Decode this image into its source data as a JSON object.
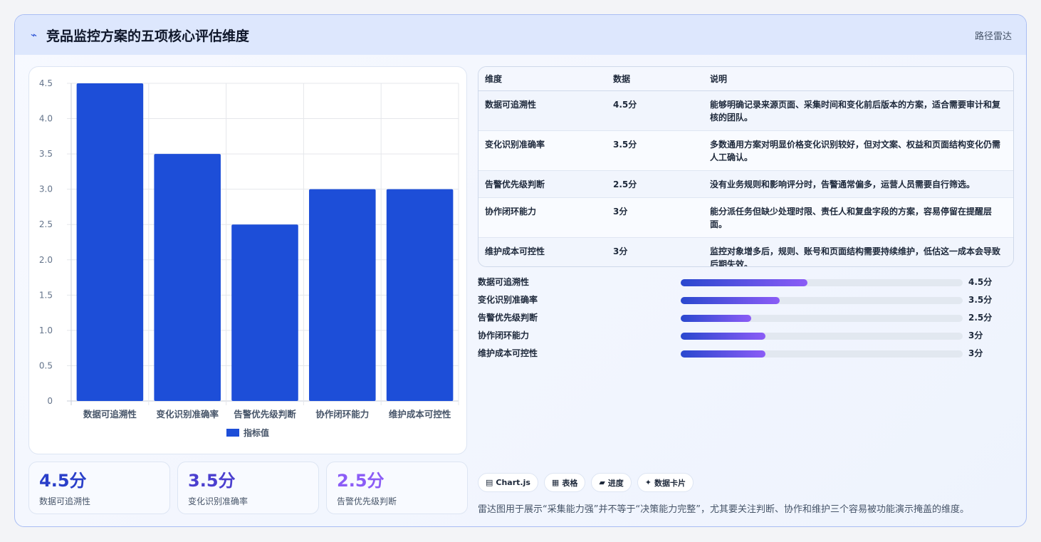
{
  "header": {
    "icon": "pulse-icon",
    "title": "竞品监控方案的五项核心评估维度",
    "tag": "路径雷达"
  },
  "chart_data": {
    "type": "bar",
    "categories": [
      "数据可追溯性",
      "变化识别准确率",
      "告警优先级判断",
      "协作闭环能力",
      "维护成本可控性"
    ],
    "series": [
      {
        "name": "指标值",
        "values": [
          4.5,
          3.5,
          2.5,
          3,
          3
        ],
        "color": "#1d4ed8"
      }
    ],
    "ylim": [
      0,
      4.5
    ],
    "yticks": [
      "0",
      "0.5",
      "1.0",
      "1.5",
      "2.0",
      "2.5",
      "3.0",
      "3.5",
      "4.0",
      "4.5"
    ],
    "grid": true,
    "legend": "bottom"
  },
  "stats": [
    {
      "value": "4.5分",
      "label": "数据可追溯性",
      "color": "#2a3fc9"
    },
    {
      "value": "3.5分",
      "label": "变化识别准确率",
      "color": "#4b3fcf"
    },
    {
      "value": "2.5分",
      "label": "告警优先级判断",
      "color": "#8b5cf6"
    }
  ],
  "table": {
    "headers": [
      "维度",
      "数据",
      "说明"
    ],
    "rows": [
      {
        "dim": "数据可追溯性",
        "score": "4.5分",
        "desc": "能够明确记录来源页面、采集时间和变化前后版本的方案，适合需要审计和复核的团队。"
      },
      {
        "dim": "变化识别准确率",
        "score": "3.5分",
        "desc": "多数通用方案对明显价格变化识别较好，但对文案、权益和页面结构变化仍需人工确认。"
      },
      {
        "dim": "告警优先级判断",
        "score": "2.5分",
        "desc": "没有业务规则和影响评分时，告警通常偏多，运营人员需要自行筛选。"
      },
      {
        "dim": "协作闭环能力",
        "score": "3分",
        "desc": "能分派任务但缺少处理时限、责任人和复盘字段的方案，容易停留在提醒层面。"
      },
      {
        "dim": "维护成本可控性",
        "score": "3分",
        "desc": "监控对象增多后，规则、账号和页面结构需要持续维护，低估这一成本会导致后期失效。"
      }
    ]
  },
  "progress": {
    "max": 10,
    "items": [
      {
        "label": "数据可追溯性",
        "value": 4.5,
        "text": "4.5分"
      },
      {
        "label": "变化识别准确率",
        "value": 3.5,
        "text": "3.5分"
      },
      {
        "label": "告警优先级判断",
        "value": 2.5,
        "text": "2.5分"
      },
      {
        "label": "协作闭环能力",
        "value": 3,
        "text": "3分"
      },
      {
        "label": "维护成本可控性",
        "value": 3,
        "text": "3分"
      }
    ]
  },
  "chips": [
    {
      "icon": "chart-icon",
      "glyph": "▤",
      "label": "Chart.js"
    },
    {
      "icon": "table-icon",
      "glyph": "▦",
      "label": "表格"
    },
    {
      "icon": "progress-icon",
      "glyph": "▰",
      "label": "进度"
    },
    {
      "icon": "card-icon",
      "glyph": "✦",
      "label": "数据卡片"
    }
  ],
  "note": "雷达图用于展示“采集能力强”并不等于“决策能力完整”，尤其要关注判断、协作和维护三个容易被功能演示掩盖的维度。"
}
